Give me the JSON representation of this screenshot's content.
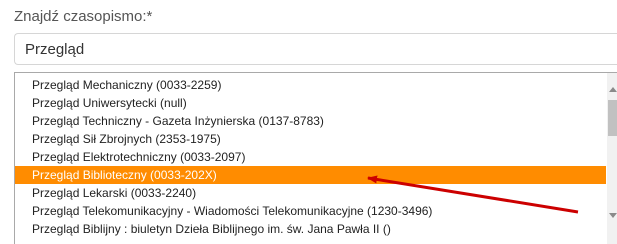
{
  "form": {
    "label": "Znajdź czasopismo:*",
    "search_value": "Przegląd"
  },
  "dropdown": {
    "items": [
      {
        "label": "Przegląd Mechaniczny (0033-2259)"
      },
      {
        "label": "Przegląd Uniwersytecki (null)"
      },
      {
        "label": "Przegląd Techniczny - Gazeta Inżynierska (0137-8783)"
      },
      {
        "label": "Przegląd Sił Zbrojnych (2353-1975)"
      },
      {
        "label": "Przegląd Elektrotechniczny (0033-2097)"
      },
      {
        "label": "Przegląd Biblioteczny (0033-202X)",
        "selected": true
      },
      {
        "label": "Przegląd Lekarski (0033-2240)"
      },
      {
        "label": "Przegląd Telekomunikacyjny - Wiadomości Telekomunikacyjne (1230-3496)"
      },
      {
        "label": "Przegląd Biblijny : biuletyn Dzieła Biblijnego im. św. Jana Pawła II ()"
      }
    ]
  },
  "annotation": {
    "arrow_color": "#cc0000"
  },
  "colors": {
    "selected_bg": "#ff8c00",
    "selected_text": "#ffffff"
  }
}
